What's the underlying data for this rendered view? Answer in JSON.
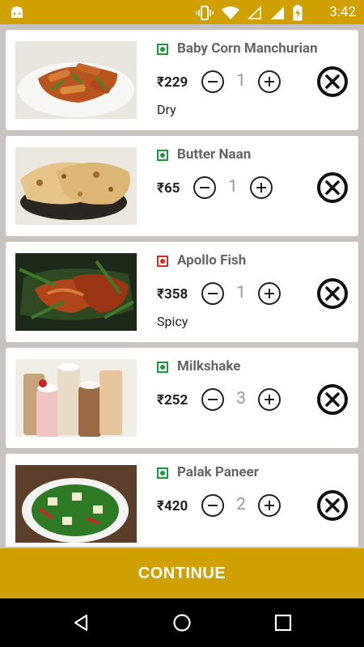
{
  "status_bar": {
    "time": "3:42",
    "icons": [
      "android-icon",
      "vibrate-icon",
      "wifi-icon",
      "signal-empty-icon",
      "signal-icon",
      "battery-charging-icon"
    ]
  },
  "cart": {
    "currency": "₹",
    "items": [
      {
        "name": "Baby Corn Manchurian",
        "price": "₹229",
        "quantity": "1",
        "note": "Dry",
        "type": "veg"
      },
      {
        "name": "Butter Naan",
        "price": "₹65",
        "quantity": "1",
        "note": "",
        "type": "veg"
      },
      {
        "name": "Apollo Fish",
        "price": "₹358",
        "quantity": "1",
        "note": "Spicy",
        "type": "non-veg"
      },
      {
        "name": "Milkshake",
        "price": "₹252",
        "quantity": "3",
        "note": "",
        "type": "veg"
      },
      {
        "name": "Palak Paneer",
        "price": "₹420",
        "quantity": "2",
        "note": "",
        "type": "veg"
      }
    ]
  },
  "footer": {
    "continue_label": "CONTINUE"
  },
  "nav": {
    "icons": [
      "back-icon",
      "home-icon",
      "recents-icon"
    ]
  },
  "colors": {
    "accent": "#d09f00",
    "veg": "#1a9a3a",
    "non_veg": "#e0271f",
    "background": "#c9c3bf"
  }
}
